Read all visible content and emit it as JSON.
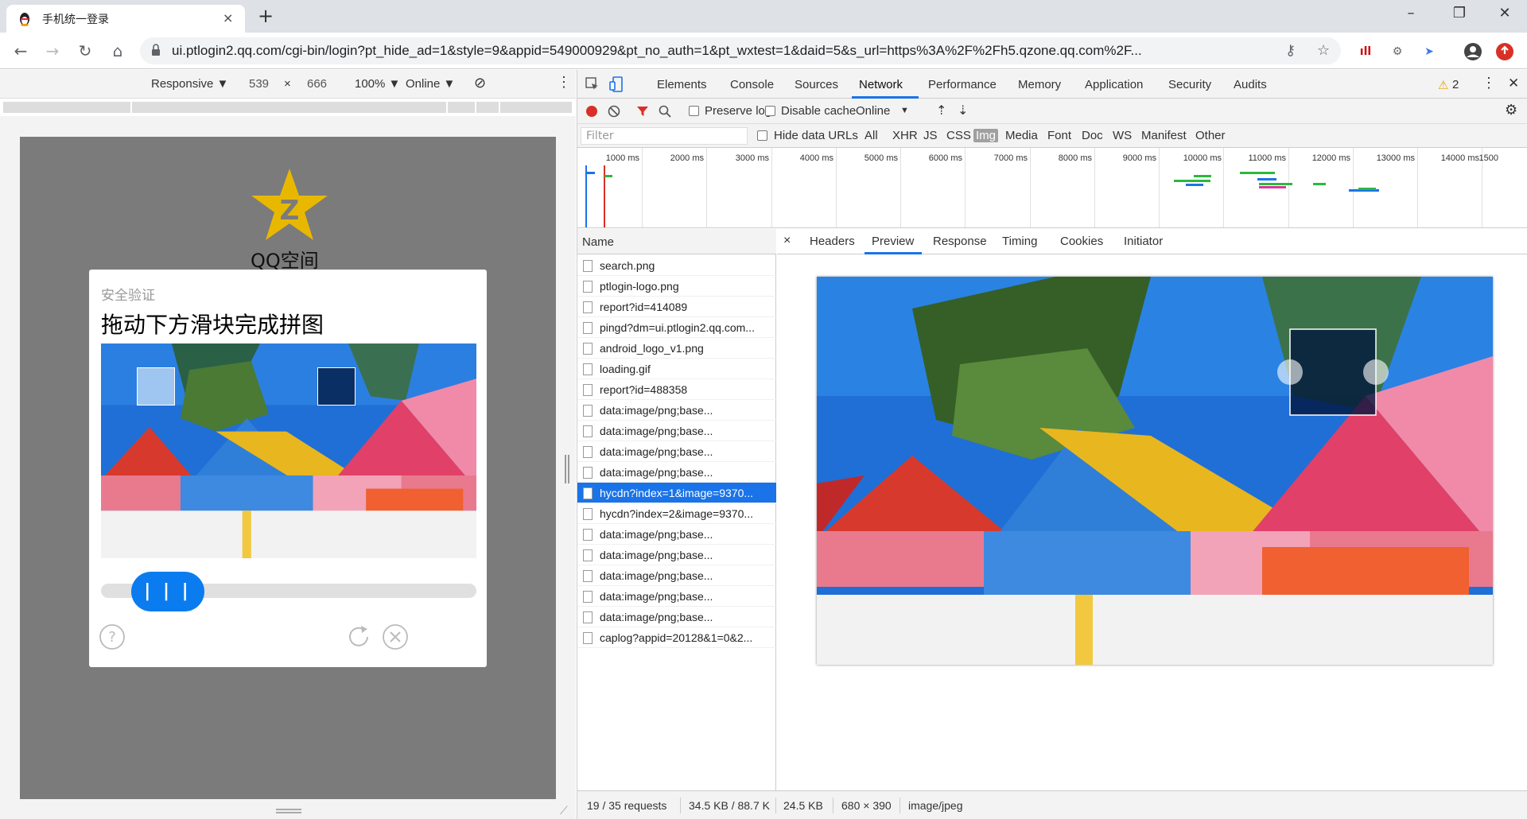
{
  "browser": {
    "tab_title": "手机统一登录",
    "tab_close": "×",
    "new_tab": "+",
    "url": "ui.ptlogin2.qq.com/cgi-bin/login?pt_hide_ad=1&style=9&appid=549000929&pt_no_auth=1&pt_wxtest=1&daid=5&s_url=https%3A%2F%2Fh5.qzone.qq.com%2F...",
    "win_minimize": "–",
    "win_maximize": "❐",
    "win_close": "✕"
  },
  "device_toolbar": {
    "mode": "Responsive ▼",
    "width": "539",
    "times": "×",
    "height": "666",
    "zoom": "100% ▼",
    "network": "Online ▼"
  },
  "page": {
    "logo_text": "QQ空间",
    "captcha": {
      "subtitle": "安全验证",
      "title": "拖动下方滑块完成拼图",
      "slider_label": "| | |"
    }
  },
  "devtools": {
    "tabs": [
      "Elements",
      "Console",
      "Sources",
      "Network",
      "Performance",
      "Memory",
      "Application",
      "Security",
      "Audits"
    ],
    "warning_count": "2",
    "toolbar": {
      "preserve_log": "Preserve log",
      "disable_cache": "Disable cache",
      "throttle": "Online"
    },
    "filter": {
      "placeholder": "Filter",
      "hide_data_urls": "Hide data URLs",
      "types": [
        "All",
        "XHR",
        "JS",
        "CSS",
        "Img",
        "Media",
        "Font",
        "Doc",
        "WS",
        "Manifest",
        "Other"
      ],
      "active_type": "Img"
    },
    "overview_labels": [
      "1000 ms",
      "2000 ms",
      "3000 ms",
      "4000 ms",
      "5000 ms",
      "6000 ms",
      "7000 ms",
      "8000 ms",
      "9000 ms",
      "10000 ms",
      "11000 ms",
      "12000 ms",
      "13000 ms",
      "14000 ms",
      "1500"
    ],
    "name_header": "Name",
    "requests": [
      "search.png",
      "ptlogin-logo.png",
      "report?id=414089",
      "pingd?dm=ui.ptlogin2.qq.com...",
      "android_logo_v1.png",
      "loading.gif",
      "report?id=488358",
      "data:image/png;base...",
      "data:image/png;base...",
      "data:image/png;base...",
      "data:image/png;base...",
      "hycdn?index=1&image=9370...",
      "hycdn?index=2&image=9370...",
      "data:image/png;base...",
      "data:image/png;base...",
      "data:image/png;base...",
      "data:image/png;base...",
      "data:image/png;base...",
      "caplog?appid=20128&1=0&2..."
    ],
    "selected_request": 11,
    "detail_close": "×",
    "detail_tabs": [
      "Headers",
      "Preview",
      "Response",
      "Timing",
      "Cookies",
      "Initiator"
    ],
    "active_detail_tab": "Preview",
    "status": {
      "requests": "19 / 35 requests",
      "transferred": "34.5 KB / 88.7 K",
      "size": "24.5 KB",
      "dimensions": "680 × 390",
      "mime": "image/jpeg"
    }
  },
  "colors": {
    "accent": "#1a73e8",
    "slider": "#0a7cf0",
    "device_bg": "#7b7b7b"
  }
}
